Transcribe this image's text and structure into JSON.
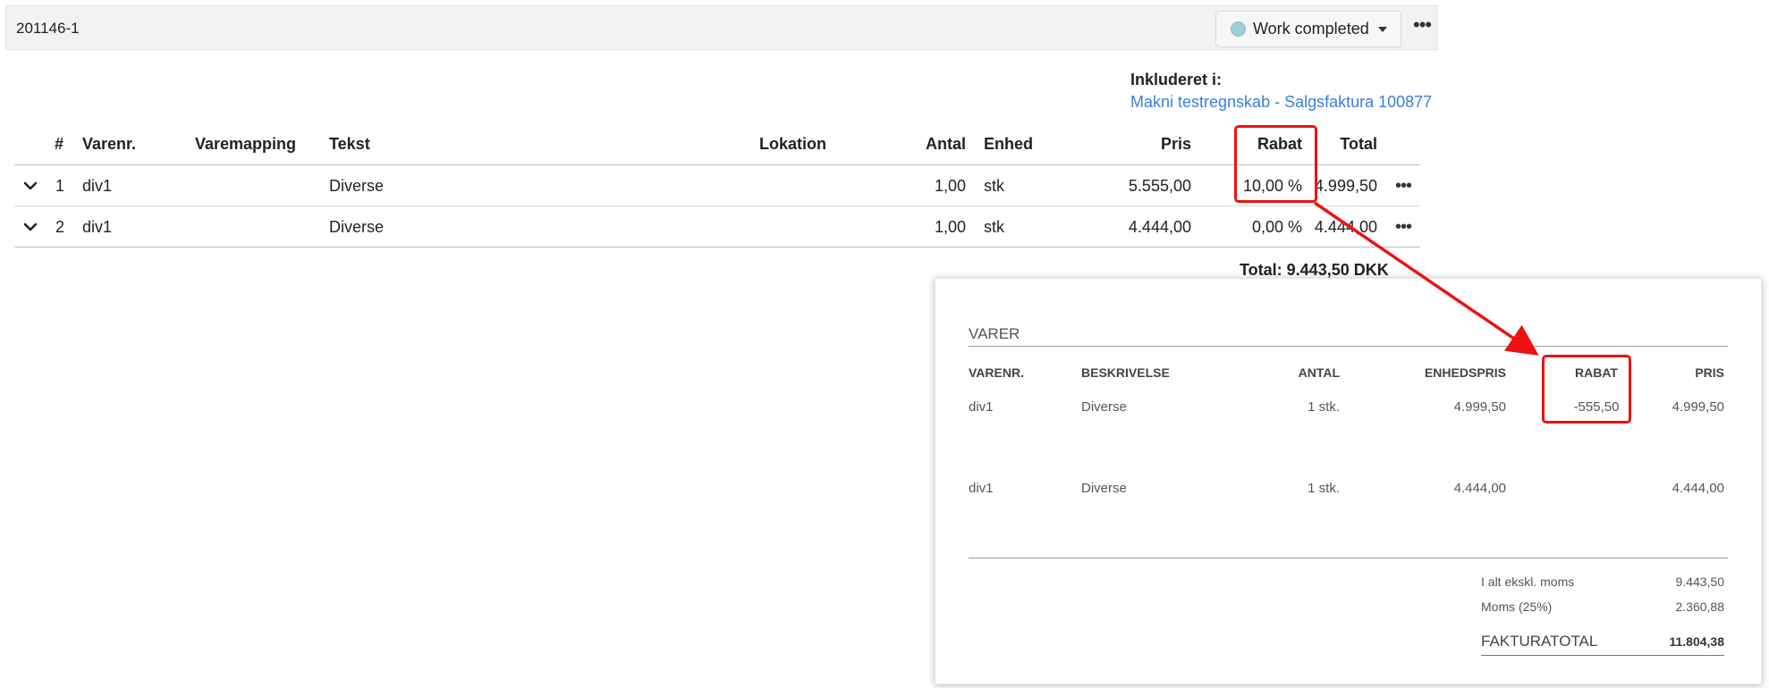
{
  "header": {
    "order_id": "201146-1",
    "status_label": "Work completed",
    "status_color": "#9ccfd7"
  },
  "included": {
    "label": "Inkluderet i:",
    "link": "Makni testregnskab - Salgsfaktura 100877"
  },
  "table": {
    "columns": {
      "num": "#",
      "varenr": "Varenr.",
      "varemapping": "Varemapping",
      "tekst": "Tekst",
      "lokation": "Lokation",
      "antal": "Antal",
      "enhed": "Enhed",
      "pris": "Pris",
      "rabat": "Rabat",
      "total": "Total"
    },
    "rows": [
      {
        "num": "1",
        "varenr": "div1",
        "varemapping": "",
        "tekst": "Diverse",
        "lokation": "",
        "antal": "1,00",
        "enhed": "stk",
        "pris": "5.555,00",
        "rabat": "10,00 %",
        "total": "4.999,50"
      },
      {
        "num": "2",
        "varenr": "div1",
        "varemapping": "",
        "tekst": "Diverse",
        "lokation": "",
        "antal": "1,00",
        "enhed": "stk",
        "pris": "4.444,00",
        "rabat": "0,00 %",
        "total": "4.444,00"
      }
    ],
    "grand_total": "Total: 9.443,50 DKK"
  },
  "invoice": {
    "section_title": "VARER",
    "columns": {
      "varenr": "VARENR.",
      "beskrivelse": "BESKRIVELSE",
      "antal": "ANTAL",
      "enhedspris": "ENHEDSPRIS",
      "rabat": "RABAT",
      "pris": "PRIS"
    },
    "rows": [
      {
        "varenr": "div1",
        "beskrivelse": "Diverse",
        "antal": "1 stk.",
        "enhedspris": "4.999,50",
        "rabat": "-555,50",
        "pris": "4.999,50"
      },
      {
        "varenr": "div1",
        "beskrivelse": "Diverse",
        "antal": "1 stk.",
        "enhedspris": "4.444,00",
        "rabat": "",
        "pris": "4.444,00"
      }
    ],
    "summary": {
      "excl_label": "I alt ekskl. moms",
      "excl_value": "9.443,50",
      "vat_label": "Moms (25%)",
      "vat_value": "2.360,88",
      "total_label": "FAKTURATOTAL",
      "total_value": "11.804,38"
    }
  },
  "annotation": {
    "highlight_color": "#ee1111"
  }
}
